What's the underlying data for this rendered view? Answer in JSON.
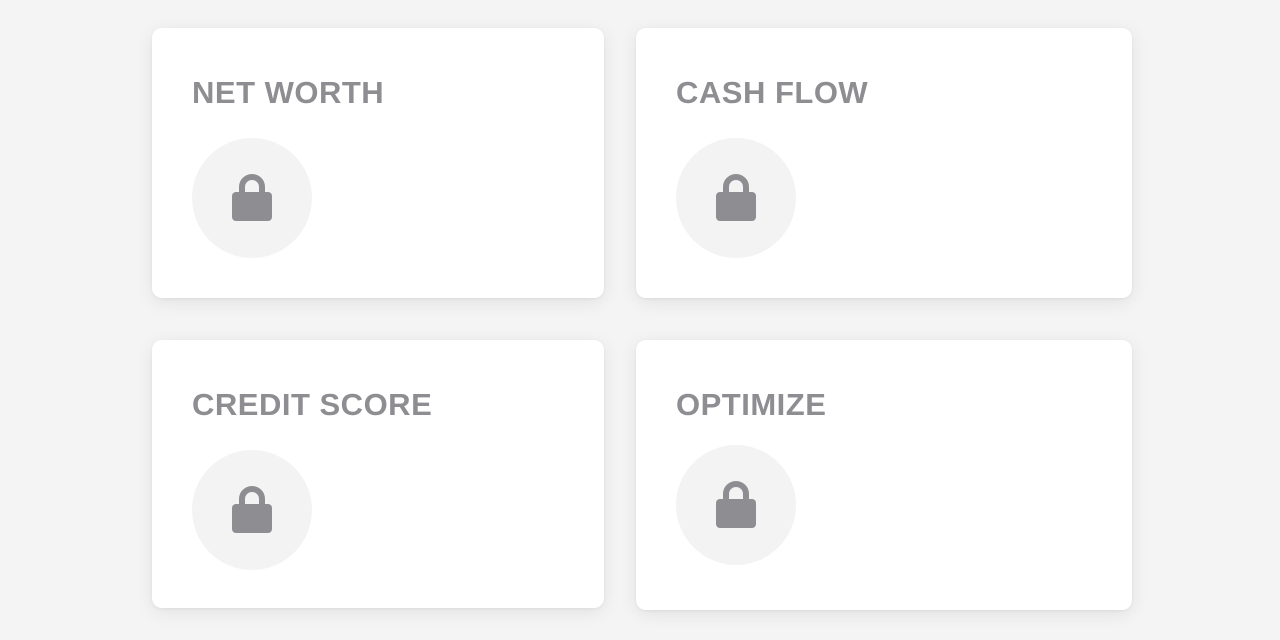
{
  "colors": {
    "background": "#f4f4f4",
    "card": "#ffffff",
    "title_text": "#8e8e92",
    "lock_circle": "#f3f3f4",
    "lock_icon": "#8e8e92"
  },
  "cards": [
    {
      "title": "NET WORTH",
      "icon": "lock-icon",
      "locked": true
    },
    {
      "title": "CASH FLOW",
      "icon": "lock-icon",
      "locked": true
    },
    {
      "title": "CREDIT SCORE",
      "icon": "lock-icon",
      "locked": true
    },
    {
      "title": "OPTIMIZE",
      "icon": "lock-icon",
      "locked": true
    }
  ]
}
